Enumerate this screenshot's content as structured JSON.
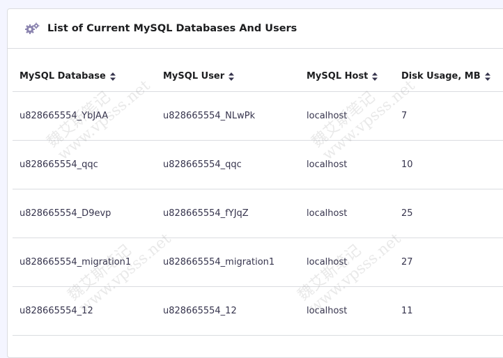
{
  "card": {
    "title": "List of Current MySQL Databases And Users",
    "icon": "gears-icon"
  },
  "table": {
    "headers": [
      "MySQL Database",
      "MySQL User",
      "MySQL Host",
      "Disk Usage, MB"
    ],
    "rows": [
      [
        "u828665554_YbJAA",
        "u828665554_NLwPk",
        "localhost",
        "7"
      ],
      [
        "u828665554_qqc",
        "u828665554_qqc",
        "localhost",
        "10"
      ],
      [
        "u828665554_D9evp",
        "u828665554_fYJqZ",
        "localhost",
        "25"
      ],
      [
        "u828665554_migration1",
        "u828665554_migration1",
        "localhost",
        "27"
      ],
      [
        "u828665554_12",
        "u828665554_12",
        "localhost",
        "11"
      ]
    ]
  },
  "watermark": {
    "line1": "魏艾斯笔记",
    "line2": "www.vpsss.net"
  },
  "colors": {
    "page_bg": "#f4f5ff",
    "header_text": "#1d1e20",
    "cell_text": "#36344d",
    "border": "#dadce0",
    "icon": "#8c85b0"
  }
}
